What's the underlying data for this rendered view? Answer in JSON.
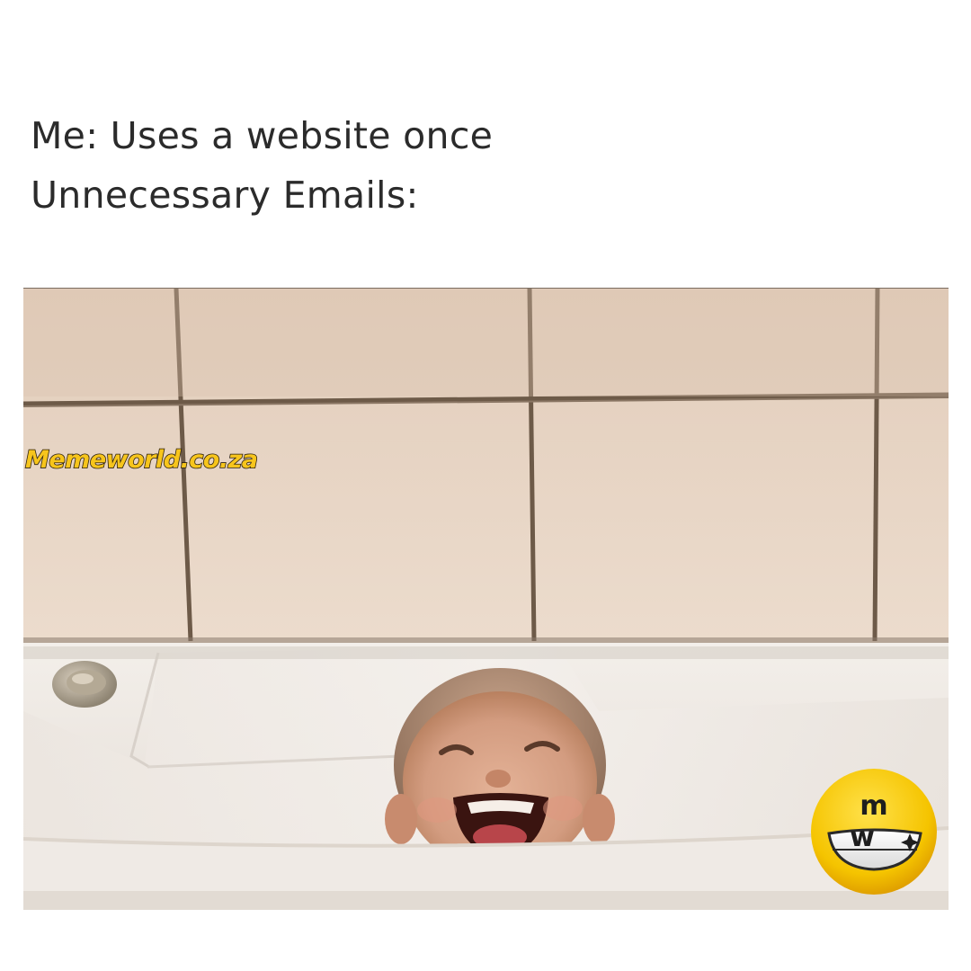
{
  "caption": {
    "line1": "Me: Uses a website once",
    "line2": "Unnecessary Emails:"
  },
  "photo": {
    "subject": "baby-in-bathtub",
    "colors": {
      "tile": "#e7d3c2",
      "grout": "#6d5a48",
      "tub": "#f0ebe6",
      "skin": "#d9a58a"
    }
  },
  "watermark": {
    "text": "Memeworld.co.za",
    "color": "#f7c51c"
  },
  "logo": {
    "letters": "m w",
    "icon": "grinning-face-icon",
    "color": "#f5c400"
  }
}
